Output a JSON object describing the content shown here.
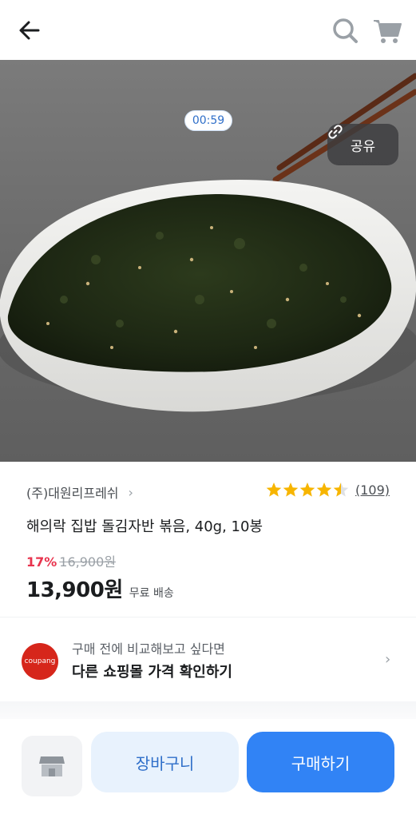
{
  "header": {
    "back_icon": "arrow-left-icon",
    "search_icon": "search-icon",
    "cart_icon": "cart-icon"
  },
  "hero": {
    "timer": "00:59",
    "share_label": "공유",
    "share_icon": "link-icon"
  },
  "product": {
    "seller": "(주)대원리프레쉬",
    "rating": 4.5,
    "review_count": "(109)",
    "title": "해의락 집밥 돌김자반 볶음, 40g, 10봉",
    "discount": "17%",
    "original_price": "16,900원",
    "price": "13,900원",
    "shipping": "무료 배송"
  },
  "compare": {
    "logo_text": "coupang",
    "subtitle": "구매 전에 비교해보고 싶다면",
    "title": "다른 쇼핑몰 가격 확인하기"
  },
  "actions": {
    "store_icon": "store-icon",
    "cart_label": "장바구니",
    "buy_label": "구매하기"
  },
  "colors": {
    "accent": "#3183f5",
    "accent_light": "#e8f2fd",
    "discount": "#e8344e",
    "star": "#f7b500",
    "coupang": "#d6261b"
  }
}
